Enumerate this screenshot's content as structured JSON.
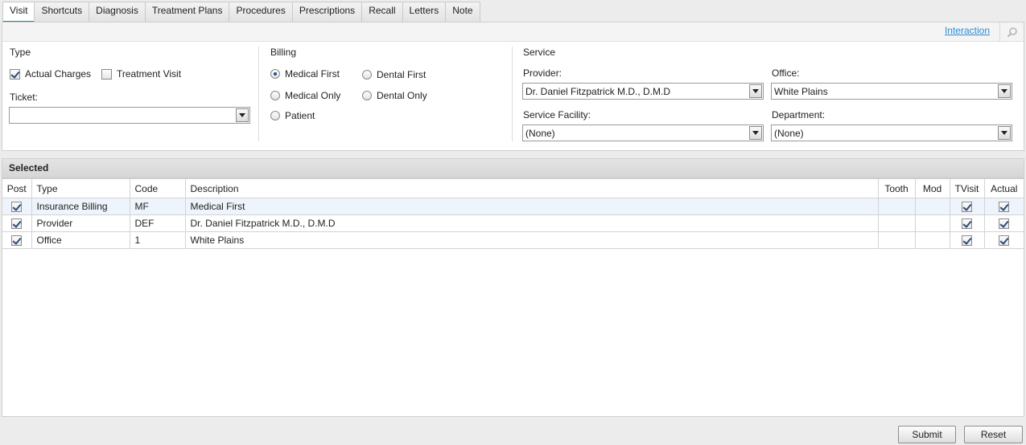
{
  "tabs": [
    {
      "label": "Visit",
      "active": true
    },
    {
      "label": "Shortcuts",
      "active": false
    },
    {
      "label": "Diagnosis",
      "active": false
    },
    {
      "label": "Treatment Plans",
      "active": false
    },
    {
      "label": "Procedures",
      "active": false
    },
    {
      "label": "Prescriptions",
      "active": false
    },
    {
      "label": "Recall",
      "active": false
    },
    {
      "label": "Letters",
      "active": false
    },
    {
      "label": "Note",
      "active": false
    }
  ],
  "toolbar": {
    "interaction_link": "Interaction",
    "search_icon": "search-icon"
  },
  "type_section": {
    "title": "Type",
    "actual_charges": {
      "label": "Actual Charges",
      "checked": true
    },
    "treatment_visit": {
      "label": "Treatment Visit",
      "checked": false
    },
    "ticket_label": "Ticket:",
    "ticket_value": ""
  },
  "billing": {
    "title": "Billing",
    "options": [
      {
        "label": "Medical First",
        "checked": true
      },
      {
        "label": "Medical Only",
        "checked": false
      },
      {
        "label": "Patient",
        "checked": false
      },
      {
        "label": "Dental First",
        "checked": false
      },
      {
        "label": "Dental Only",
        "checked": false
      }
    ]
  },
  "service": {
    "title": "Service",
    "provider_label": "Provider:",
    "provider_value": "Dr. Daniel Fitzpatrick M.D., D.M.D",
    "office_label": "Office:",
    "office_value": "White Plains",
    "facility_label": "Service Facility:",
    "facility_value": "(None)",
    "department_label": "Department:",
    "department_value": "(None)"
  },
  "selected": {
    "title": "Selected",
    "columns": [
      "Post",
      "Type",
      "Code",
      "Description",
      "Tooth",
      "Mod",
      "TVisit",
      "Actual"
    ],
    "rows": [
      {
        "post": true,
        "type": "Insurance Billing",
        "code": "MF",
        "description": "Medical First",
        "tooth": "",
        "mod": "",
        "tvisit": true,
        "actual": true
      },
      {
        "post": true,
        "type": "Provider",
        "code": "DEF",
        "description": "Dr. Daniel Fitzpatrick M.D., D.M.D",
        "tooth": "",
        "mod": "",
        "tvisit": true,
        "actual": true
      },
      {
        "post": true,
        "type": "Office",
        "code": "1",
        "description": "White Plains",
        "tooth": "",
        "mod": "",
        "tvisit": true,
        "actual": true
      }
    ]
  },
  "buttons": {
    "submit": "Submit",
    "reset": "Reset"
  },
  "colors": {
    "accent": "#1c8ea3",
    "link": "#2a8cd6",
    "selected_row": "#eef4fb"
  }
}
